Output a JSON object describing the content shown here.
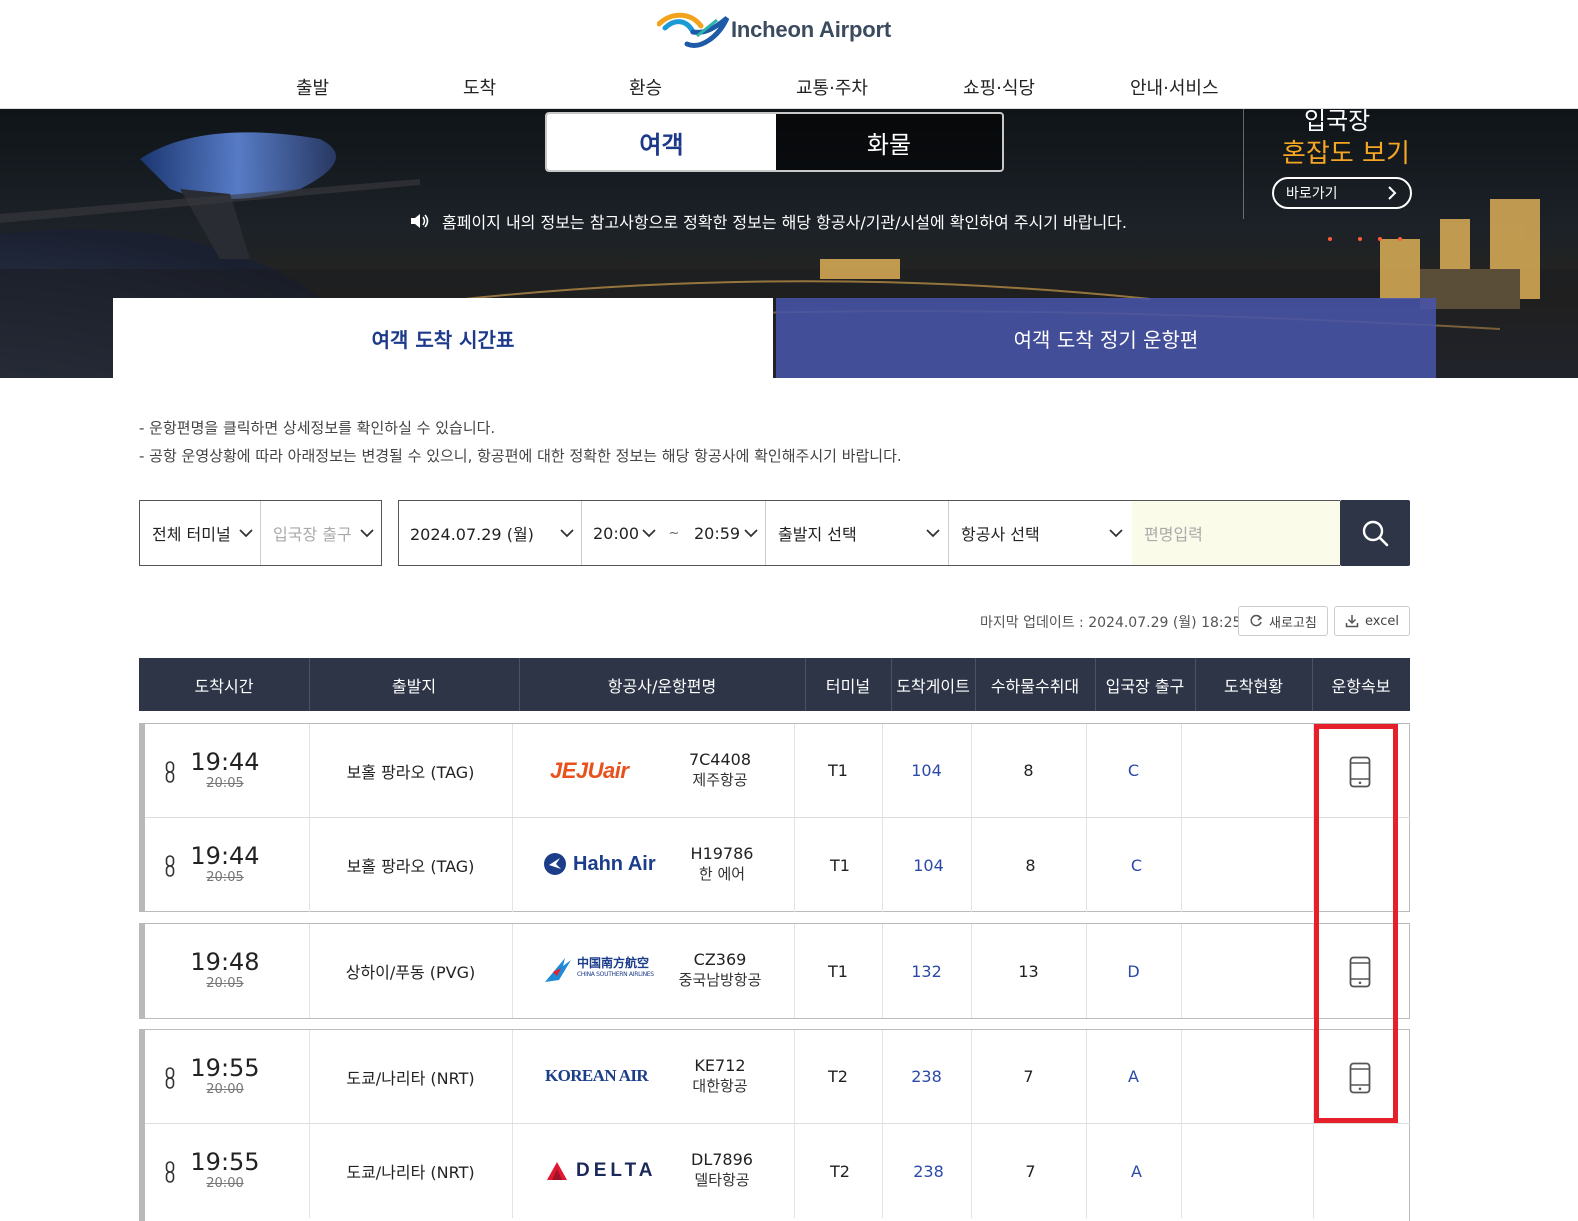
{
  "header": {
    "logo_text": "Incheon Airport",
    "nav": [
      "출발",
      "도착",
      "환승",
      "교통·주차",
      "쇼핑·식당",
      "안내·서비스"
    ]
  },
  "hero": {
    "toggle_passenger": "여객",
    "toggle_cargo": "화물",
    "notice": "홈페이지 내의 정보는 참고사항으로 정확한 정보는 해당 항공사/기관/시설에 확인하여 주시기 바랍니다.",
    "congestion_line1": "입국장",
    "congestion_line2": "혼잡도 보기",
    "congestion_button": "바로가기",
    "tab_active": "여객 도착 시간표",
    "tab_other": "여객 도착 정기 운항편"
  },
  "info": [
    "-  운항편명을 클릭하면 상세정보를 확인하실 수 있습니다.",
    "-  공항 운영상황에 따라 아래정보는 변경될 수 있으니, 항공편에 대한 정확한 정보는 해당 항공사에 확인해주시기 바랍니다."
  ],
  "search": {
    "terminal": "전체 터미널",
    "exit": "입국장 출구",
    "date": "2024.07.29 (월)",
    "time_from": "20:00",
    "tilde": "~",
    "time_to": "20:59",
    "origin": "출발지 선택",
    "airline": "항공사 선택",
    "flight_placeholder": "편명입력"
  },
  "update": {
    "text": "마지막 업데이트 : 2024.07.29 (월) 18:25",
    "refresh": "새로고침",
    "excel": "excel"
  },
  "table": {
    "headers": [
      "도착시간",
      "출발지",
      "항공사/운항편명",
      "터미널",
      "도착게이트",
      "수하물수취대",
      "입국장 출구",
      "도착현황",
      "운항속보"
    ],
    "rows": [
      {
        "time": "19:44",
        "scheduled": "20:05",
        "origin": "보홀 팡라오 (TAG)",
        "airline_logo": "JEJUair",
        "flight": "7C4408",
        "airline": "제주항공",
        "terminal": "T1",
        "gate": "104",
        "carousel": "8",
        "exit": "C",
        "status": "",
        "share_icon": true,
        "phone_icon": true
      },
      {
        "time": "19:44",
        "scheduled": "20:05",
        "origin": "보홀 팡라오 (TAG)",
        "airline_logo": "Hahn Air",
        "flight": "H19786",
        "airline": "한 에어",
        "terminal": "T1",
        "gate": "104",
        "carousel": "8",
        "exit": "C",
        "status": "",
        "share_icon": true,
        "phone_icon": false
      },
      {
        "time": "19:48",
        "scheduled": "20:05",
        "origin": "상하이/푸동 (PVG)",
        "airline_logo": "中国南方航空",
        "airline_logo_sub": "CHINA SOUTHERN AIRLINES",
        "flight": "CZ369",
        "airline": "중국남방항공",
        "terminal": "T1",
        "gate": "132",
        "carousel": "13",
        "exit": "D",
        "status": "",
        "share_icon": false,
        "phone_icon": true
      },
      {
        "time": "19:55",
        "scheduled": "20:00",
        "origin": "도쿄/나리타 (NRT)",
        "airline_logo": "KOREAN AIR",
        "flight": "KE712",
        "airline": "대한항공",
        "terminal": "T2",
        "gate": "238",
        "carousel": "7",
        "exit": "A",
        "status": "",
        "share_icon": true,
        "phone_icon": true
      },
      {
        "time": "19:55",
        "scheduled": "20:00",
        "origin": "도쿄/나리타 (NRT)",
        "airline_logo": "DELTA",
        "flight": "DL7896",
        "airline": "델타항공",
        "terminal": "T2",
        "gate": "238",
        "carousel": "7",
        "exit": "A",
        "status": "",
        "share_icon": true,
        "phone_icon": false
      }
    ]
  },
  "colors": {
    "navy": "#2e3547",
    "brand_blue": "#1d3a8a",
    "link_blue": "#2b4aa8",
    "highlight_red": "#e5202a",
    "congestion_orange": "#f5a623"
  }
}
